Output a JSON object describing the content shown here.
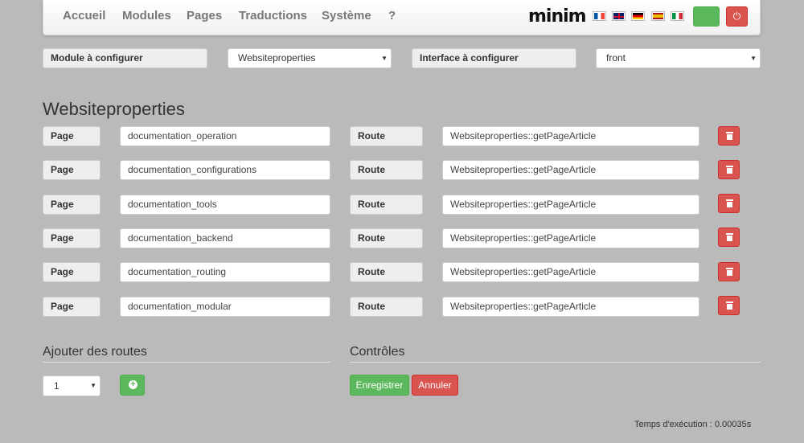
{
  "nav": {
    "items": [
      "Accueil",
      "Modules",
      "Pages",
      "Traductions",
      "Système",
      "?"
    ],
    "logo": "minim",
    "flags": [
      "flag-fr",
      "flag-gb",
      "flag-de",
      "flag-es",
      "flag-it"
    ],
    "power_icon": "power-icon"
  },
  "config": {
    "module_label": "Module à configurer",
    "module_value": "Websiteproperties",
    "interface_label": "Interface à configurer",
    "interface_value": "front"
  },
  "title": "Websiteproperties",
  "routes": [
    {
      "page_label": "Page",
      "page_value": "documentation_operation",
      "route_label": "Route",
      "route_value": "Websiteproperties::getPageArticle"
    },
    {
      "page_label": "Page",
      "page_value": "documentation_configurations",
      "route_label": "Route",
      "route_value": "Websiteproperties::getPageArticle"
    },
    {
      "page_label": "Page",
      "page_value": "documentation_tools",
      "route_label": "Route",
      "route_value": "Websiteproperties::getPageArticle"
    },
    {
      "page_label": "Page",
      "page_value": "documentation_backend",
      "route_label": "Route",
      "route_value": "Websiteproperties::getPageArticle"
    },
    {
      "page_label": "Page",
      "page_value": "documentation_routing",
      "route_label": "Route",
      "route_value": "Websiteproperties::getPageArticle"
    },
    {
      "page_label": "Page",
      "page_value": "documentation_modular",
      "route_label": "Route",
      "route_value": "Websiteproperties::getPageArticle"
    }
  ],
  "add_routes": {
    "title": "Ajouter des routes",
    "count_value": "1"
  },
  "controls": {
    "title": "Contrôles",
    "save_label": "Enregistrer",
    "cancel_label": "Annuler"
  },
  "footer": {
    "exec_time": "Temps d'exécution : 0.00035s"
  },
  "colors": {
    "background": "#bababa",
    "success": "#5cb85c",
    "danger": "#d9534f"
  }
}
